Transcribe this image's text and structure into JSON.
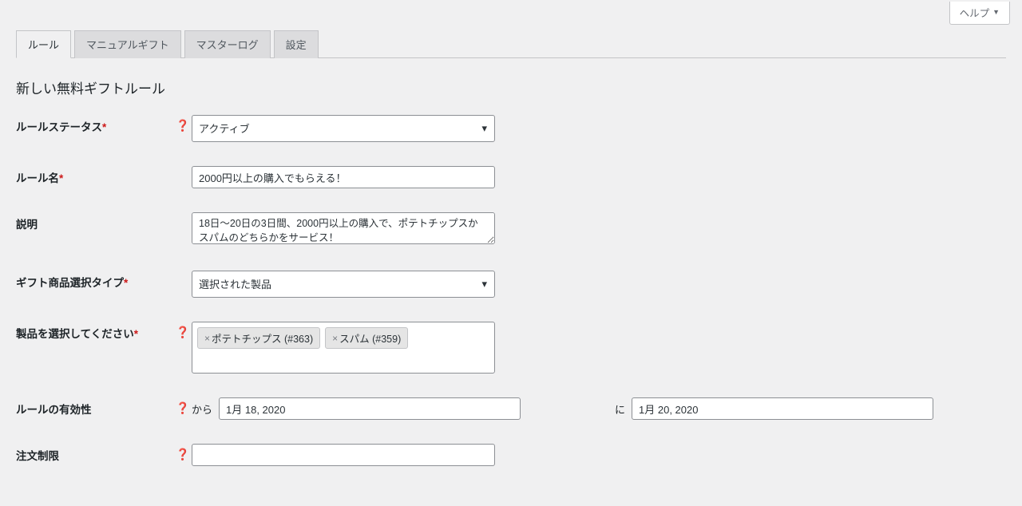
{
  "help_button": "ヘルプ",
  "tabs": {
    "rules": "ルール",
    "manual_gift": "マニュアルギフト",
    "master_log": "マスターログ",
    "settings": "設定"
  },
  "page_title": "新しい無料ギフトルール",
  "labels": {
    "rule_status": "ルールステータス",
    "rule_name": "ルール名",
    "description": "説明",
    "gift_type": "ギフト商品選択タイプ",
    "select_products": "製品を選択してください",
    "rule_validity": "ルールの有効性",
    "from": "から",
    "to": "に",
    "order_limit": "注文制限"
  },
  "values": {
    "rule_status": "アクティブ",
    "rule_name": "2000円以上の購入でもらえる！",
    "description": "18日～20日の3日間、2000円以上の購入で、ポテトチップスかスパムのどちらかをサービス！",
    "gift_type": "選択された製品",
    "date_from": "1月 18, 2020",
    "date_to": "1月 20, 2020",
    "order_limit": ""
  },
  "products": [
    {
      "label": "ポテトチップス (#363)"
    },
    {
      "label": "スパム (#359)"
    }
  ]
}
